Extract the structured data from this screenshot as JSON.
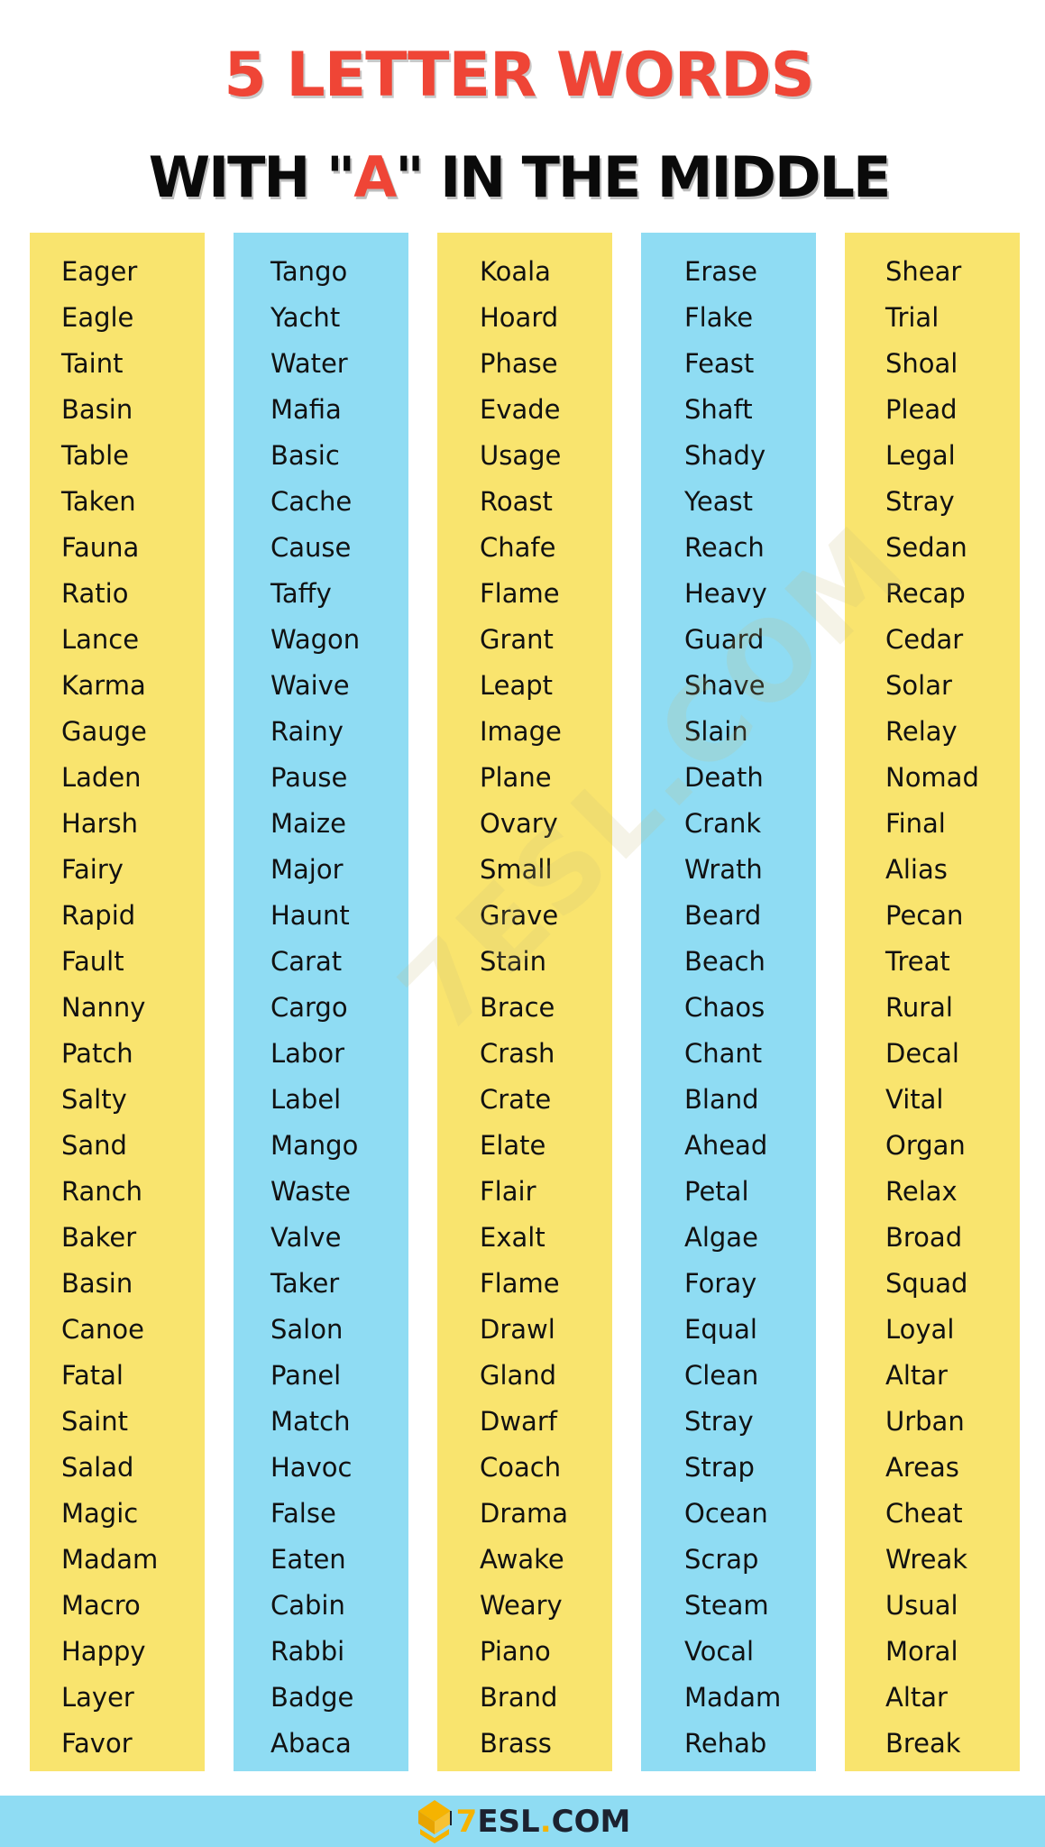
{
  "header": {
    "title_line1": "5 LETTER WORDS",
    "title_line2_prefix": "WITH \"",
    "title_line2_highlight": "A",
    "title_line2_suffix": "\" IN THE MIDDLE"
  },
  "colors": {
    "title_red": "#ef4536",
    "yellow_column": "#f9e46e",
    "blue_column": "#8fdcf3",
    "footer_band": "#8fdcf3",
    "logo_gold": "#f5b301",
    "text_dark": "#111111"
  },
  "columns": [
    {
      "color": "yellow",
      "words": [
        "Eager",
        "Eagle",
        "Taint",
        "Basin",
        "Table",
        "Taken",
        "Fauna",
        "Ratio",
        "Lance",
        "Karma",
        "Gauge",
        "Laden",
        "Harsh",
        "Fairy",
        "Rapid",
        "Fault",
        "Nanny",
        "Patch",
        "Salty",
        "Sand",
        "Ranch",
        "Baker",
        "Basin",
        "Canoe",
        "Fatal",
        "Saint",
        "Salad",
        "Magic",
        "Madam",
        "Macro",
        "Happy",
        "Layer",
        "Favor"
      ]
    },
    {
      "color": "blue",
      "words": [
        "Tango",
        "Yacht",
        "Water",
        "Mafia",
        "Basic",
        "Cache",
        "Cause",
        "Taffy",
        "Wagon",
        "Waive",
        "Rainy",
        "Pause",
        "Maize",
        "Major",
        "Haunt",
        "Carat",
        "Cargo",
        "Labor",
        "Label",
        "Mango",
        "Waste",
        "Valve",
        "Taker",
        "Salon",
        "Panel",
        "Match",
        "Havoc",
        "False",
        "Eaten",
        "Cabin",
        "Rabbi",
        "Badge",
        "Abaca"
      ]
    },
    {
      "color": "yellow",
      "words": [
        "Koala",
        "Hoard",
        "Phase",
        "Evade",
        "Usage",
        "Roast",
        "Chafe",
        "Flame",
        "Grant",
        "Leapt",
        "Image",
        "Plane",
        "Ovary",
        "Small",
        "Grave",
        "Stain",
        "Brace",
        "Crash",
        "Crate",
        "Elate",
        "Flair",
        "Exalt",
        "Flame",
        "Drawl",
        "Gland",
        "Dwarf",
        "Coach",
        "Drama",
        "Awake",
        "Weary",
        "Piano",
        "Brand",
        "Brass"
      ]
    },
    {
      "color": "blue",
      "words": [
        "Erase",
        "Flake",
        "Feast",
        "Shaft",
        "Shady",
        "Yeast",
        "Reach",
        "Heavy",
        "Guard",
        "Shave",
        "Slain",
        "Death",
        "Crank",
        "Wrath",
        "Beard",
        "Beach",
        "Chaos",
        "Chant",
        "Bland",
        "Ahead",
        "Petal",
        "Algae",
        "Foray",
        "Equal",
        "Clean",
        "Stray",
        "Strap",
        "Ocean",
        "Scrap",
        "Steam",
        "Vocal",
        "Madam",
        "Rehab"
      ]
    },
    {
      "color": "yellow",
      "words": [
        "Shear",
        "Trial",
        "Shoal",
        "Plead",
        "Legal",
        "Stray",
        "Sedan",
        "Recap",
        "Cedar",
        "Solar",
        "Relay",
        "Nomad",
        "Final",
        "Alias",
        "Pecan",
        "Treat",
        "Rural",
        "Decal",
        "Vital",
        "Organ",
        "Relax",
        "Broad",
        "Squad",
        "Loyal",
        "Altar",
        "Urban",
        "Areas",
        "Cheat",
        "Wreak",
        "Usual",
        "Moral",
        "Altar",
        "Break"
      ]
    }
  ],
  "watermark": {
    "text": "7ESL.COM"
  },
  "footer": {
    "logo_icon": "graduation-cap-icon",
    "logo_seven": "7",
    "logo_main": "ESL",
    "logo_dot": ".",
    "logo_tld": "COM"
  }
}
